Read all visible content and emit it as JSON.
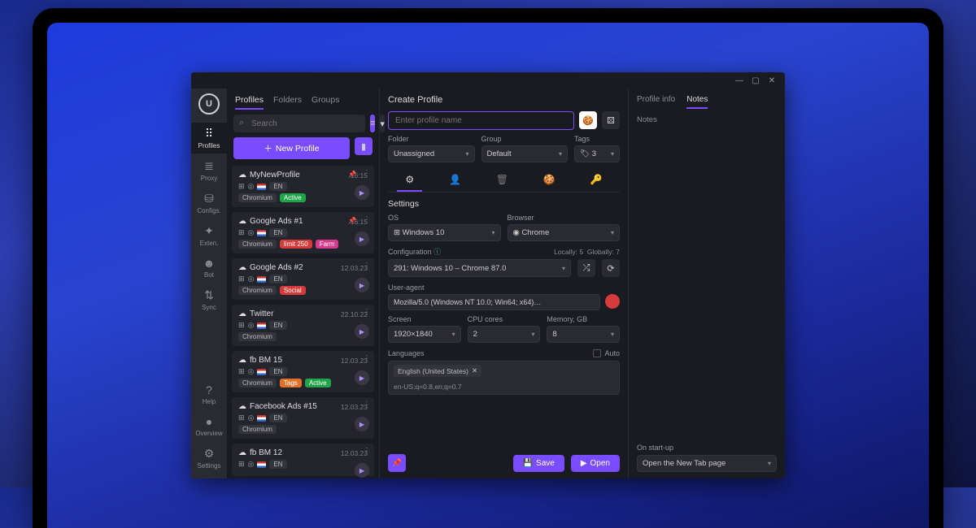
{
  "nav": {
    "items": [
      {
        "label": "Profiles",
        "active": true
      },
      {
        "label": "Proxy"
      },
      {
        "label": "Configs."
      },
      {
        "label": "Exten."
      },
      {
        "label": "Bot"
      },
      {
        "label": "Sync"
      }
    ],
    "bottom": [
      {
        "label": "Help"
      },
      {
        "label": "Overview"
      },
      {
        "label": "Settings"
      }
    ]
  },
  "list": {
    "tabs": [
      "Profiles",
      "Folders",
      "Groups"
    ],
    "active_tab": 0,
    "search_placeholder": "Search",
    "new_profile": "New Profile",
    "items": [
      {
        "name": "MyNewProfile",
        "ts": "16:15",
        "pinned": true,
        "chips": [
          {
            "t": "Chromium"
          },
          {
            "t": "Active",
            "c": "green"
          }
        ]
      },
      {
        "name": "Google Ads #1",
        "ts": "16:15",
        "pinned": true,
        "chips": [
          {
            "t": "Chromium"
          },
          {
            "t": "limit 250",
            "c": "red"
          },
          {
            "t": "Farm",
            "c": "pink"
          }
        ]
      },
      {
        "name": "Google Ads #2",
        "ts": "12.03.23",
        "chips": [
          {
            "t": "Chromium"
          },
          {
            "t": "Social",
            "c": "red"
          }
        ]
      },
      {
        "name": "Twitter",
        "ts": "22.10.22",
        "chips": [
          {
            "t": "Chromium"
          }
        ]
      },
      {
        "name": "fb BM 15",
        "ts": "12.03.23",
        "chips": [
          {
            "t": "Chromium"
          },
          {
            "t": "Tags",
            "c": "orange"
          },
          {
            "t": "Active",
            "c": "green"
          }
        ]
      },
      {
        "name": "Facebook Ads #15",
        "ts": "12.03.23",
        "chips": [
          {
            "t": "Chromium"
          }
        ]
      },
      {
        "name": "fb BM 12",
        "ts": "12.03.23",
        "chips": []
      }
    ],
    "lang_badge": "EN"
  },
  "editor": {
    "title": "Create Profile",
    "name_placeholder": "Enter profile name",
    "folder_label": "Folder",
    "folder_value": "Unassigned",
    "group_label": "Group",
    "group_value": "Default",
    "tags_label": "Tags",
    "tags_value": "3",
    "settings_title": "Settings",
    "os_label": "OS",
    "os_value": "Windows 10",
    "browser_label": "Browser",
    "browser_value": "Chrome",
    "config_label": "Configuration",
    "config_value": "291: Windows 10 – Chrome 87.0",
    "locally": "Locally: 5",
    "globally": "Globally: 7",
    "ua_label": "User-agent",
    "ua_value": "Mozilla/5.0 (Windows NT 10.0; Win64; x64)…",
    "screen_label": "Screen",
    "screen_value": "1920×1840",
    "cpu_label": "CPU cores",
    "cpu_value": "2",
    "mem_label": "Memory, GB",
    "mem_value": "8",
    "lang_label": "Languages",
    "auto": "Auto",
    "lang_chip": "English (United States)",
    "lang_q": "en-US;q=0.8,en;q=0.7",
    "save": "Save",
    "open": "Open"
  },
  "side": {
    "tabs": [
      "Profile info",
      "Notes"
    ],
    "active": 1,
    "notes_placeholder": "Notes",
    "startup_label": "On start-up",
    "startup_value": "Open the New Tab page"
  }
}
